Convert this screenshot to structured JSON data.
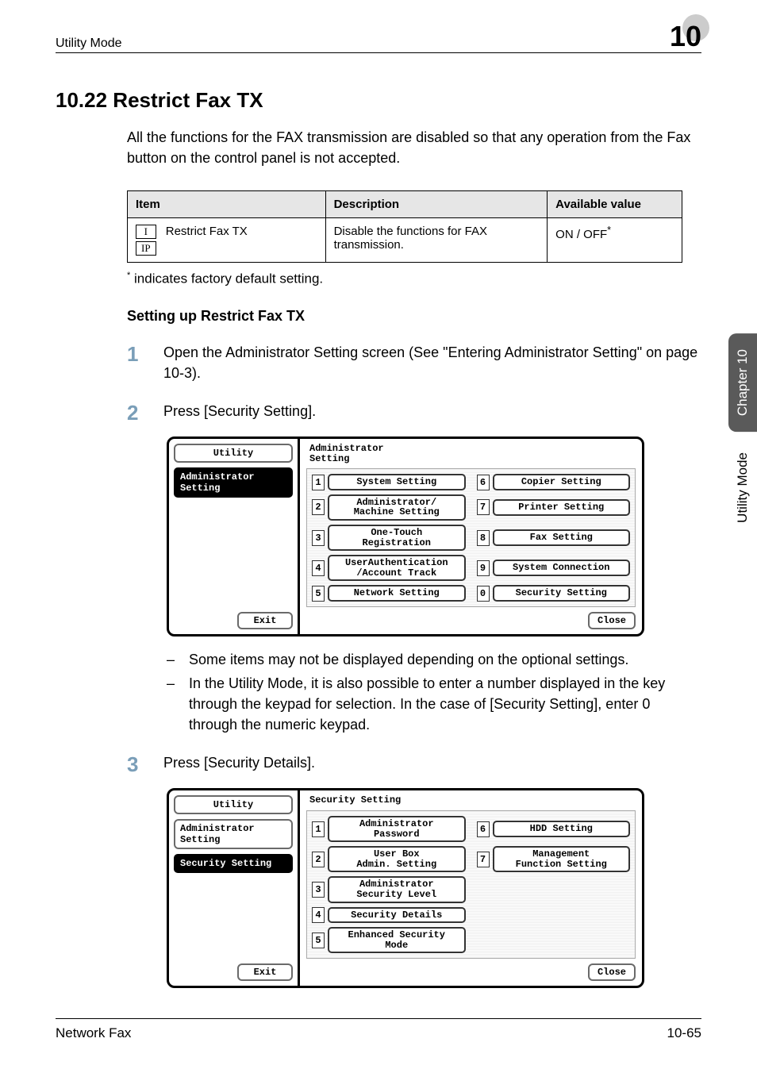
{
  "header": {
    "section_name": "Utility Mode",
    "chapter_number": "10"
  },
  "section": {
    "title": "10.22  Restrict Fax TX",
    "intro": "All the functions for the FAX transmission are disabled so that any operation from the Fax button on the control panel is not accepted."
  },
  "table": {
    "headers": {
      "item": "Item",
      "description": "Description",
      "available": "Available value"
    },
    "row": {
      "icon_top": "I",
      "icon_bottom": "IP",
      "item": "Restrict Fax TX",
      "description": "Disable the functions for FAX transmission.",
      "available": "ON / OFF",
      "asterisk": "*"
    }
  },
  "footnote": {
    "asterisk": "*",
    "text": " indicates factory default setting."
  },
  "subheading": "Setting up Restrict Fax TX",
  "steps": {
    "s1": {
      "num": "1",
      "text": "Open the Administrator Setting screen (See \"Entering Administrator Setting\" on page 10-3)."
    },
    "s2": {
      "num": "2",
      "text": "Press [Security Setting]."
    },
    "s3": {
      "num": "3",
      "text": "Press [Security Details]."
    }
  },
  "screen1": {
    "left": {
      "utility": "Utility",
      "admin": "Administrator\nSetting",
      "exit": "Exit"
    },
    "title": "Administrator\nSetting",
    "items_left": [
      {
        "n": "1",
        "label": "System Setting"
      },
      {
        "n": "2",
        "label": "Administrator/\nMachine Setting"
      },
      {
        "n": "3",
        "label": "One-Touch\nRegistration"
      },
      {
        "n": "4",
        "label": "UserAuthentication\n/Account Track"
      },
      {
        "n": "5",
        "label": "Network Setting"
      }
    ],
    "items_right": [
      {
        "n": "6",
        "label": "Copier Setting"
      },
      {
        "n": "7",
        "label": "Printer Setting"
      },
      {
        "n": "8",
        "label": "Fax Setting"
      },
      {
        "n": "9",
        "label": "System Connection"
      },
      {
        "n": "0",
        "label": "Security Setting"
      }
    ],
    "close": "Close"
  },
  "bullets": [
    "Some items may not be displayed depending on the optional settings.",
    "In the Utility Mode, it is also possible to enter a number displayed in the key through the keypad for selection. In the case of [Security Setting], enter 0 through the numeric keypad."
  ],
  "screen2": {
    "left": {
      "utility": "Utility",
      "admin": "Administrator\nSetting",
      "security": "Security Setting",
      "exit": "Exit"
    },
    "title": "Security Setting",
    "items_left": [
      {
        "n": "1",
        "label": "Administrator\nPassword"
      },
      {
        "n": "2",
        "label": "User Box\nAdmin. Setting"
      },
      {
        "n": "3",
        "label": "Administrator\nSecurity Level"
      },
      {
        "n": "4",
        "label": "Security Details"
      },
      {
        "n": "5",
        "label": "Enhanced Security\nMode"
      }
    ],
    "items_right": [
      {
        "n": "6",
        "label": "HDD Setting"
      },
      {
        "n": "7",
        "label": "Management\nFunction Setting"
      }
    ],
    "close": "Close"
  },
  "side_tabs": {
    "dark": "Chapter 10",
    "light": "Utility Mode"
  },
  "footer": {
    "left": "Network Fax",
    "right": "10-65"
  }
}
